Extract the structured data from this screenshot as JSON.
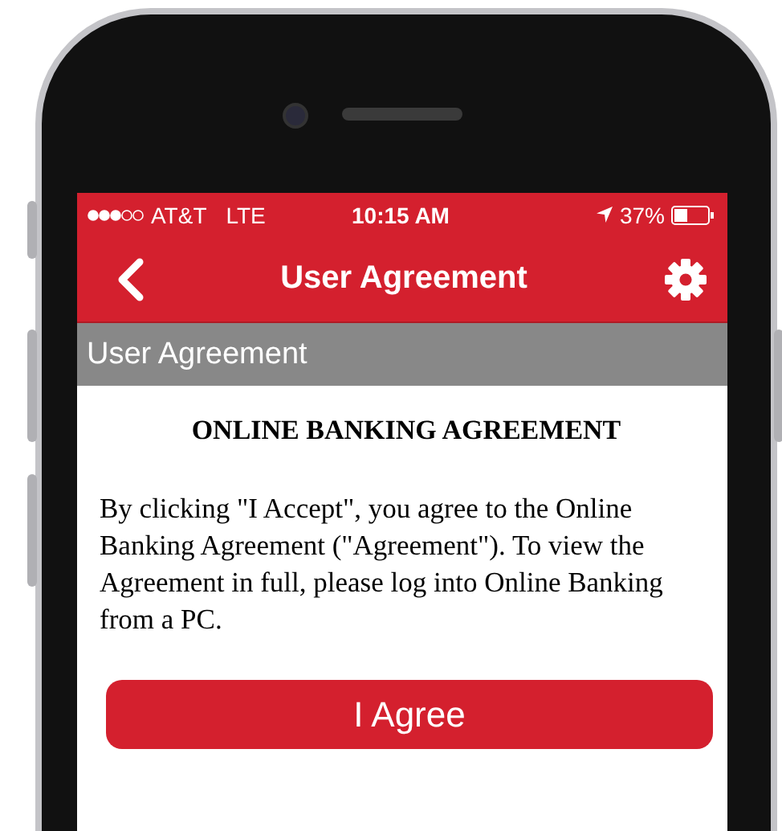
{
  "status_bar": {
    "carrier": "AT&T",
    "network": "LTE",
    "time": "10:15 AM",
    "battery": "37%"
  },
  "nav_bar": {
    "title": "User Agreement"
  },
  "section_header": {
    "title": "User Agreement"
  },
  "content": {
    "heading": "ONLINE BANKING AGREEMENT",
    "body": "By clicking \"I Accept\", you agree to the Online Banking Agreement (\"Agreement\"). To view the Agreement in full, please log into Online Banking from a PC."
  },
  "buttons": [
    {
      "label": "I Agree"
    }
  ]
}
